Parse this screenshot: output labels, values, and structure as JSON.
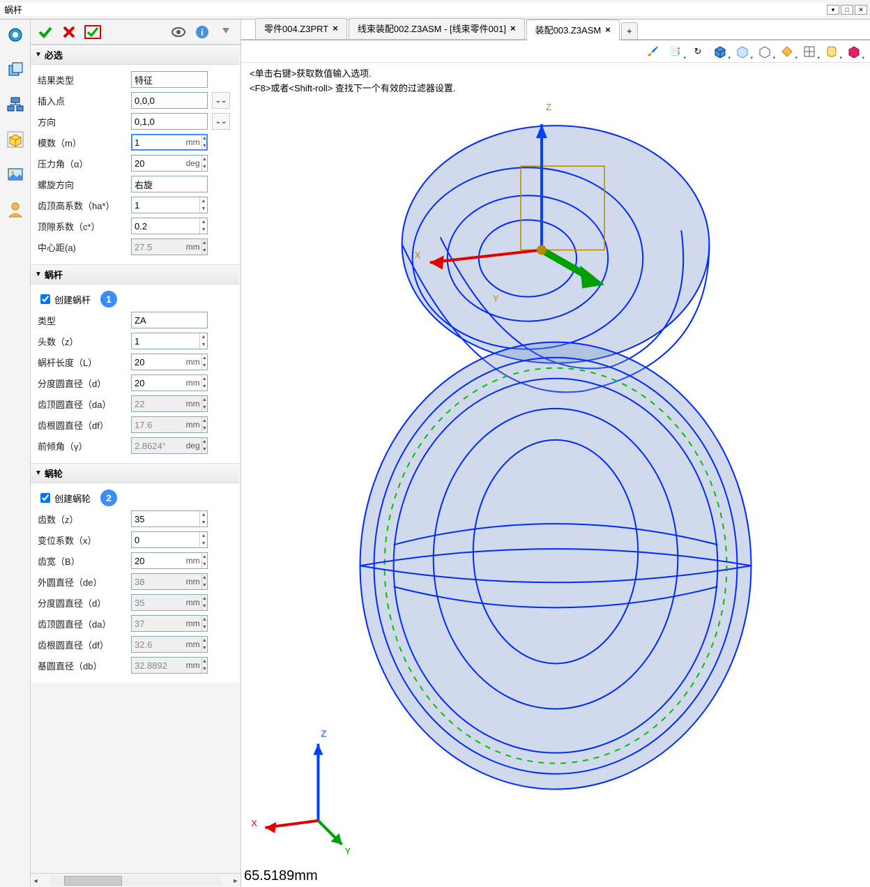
{
  "panel_title": "蜗杆",
  "tabs": [
    {
      "label": "零件004.Z3PRT",
      "active": false
    },
    {
      "label": "线束装配002.Z3ASM - [线束零件001]",
      "active": false
    },
    {
      "label": "装配003.Z3ASM",
      "active": true
    }
  ],
  "hints": [
    "<单击右键>获取数值输入选项.",
    "<F8>或者<Shift-roll> 查找下一个有效的过滤器设置."
  ],
  "readout": "65.5189mm",
  "axis_top": {
    "x": "X",
    "y": "Y",
    "z": "Z"
  },
  "axis_bottom": {
    "x": "X",
    "y": "Y",
    "z": "Z"
  },
  "sections": {
    "required": {
      "title": "必选",
      "result_type_label": "结果类型",
      "result_type_value": "特征",
      "insert_pt_label": "插入点",
      "insert_pt_value": "0,0,0",
      "direction_label": "方向",
      "direction_value": "0,1,0",
      "module_label": "模数（m）",
      "module_value": "1",
      "module_unit": "mm",
      "pressure_label": "压力角（α）",
      "pressure_value": "20",
      "pressure_unit": "deg",
      "helix_dir_label": "螺旋方向",
      "helix_dir_value": "右旋",
      "addendum_label": "齿顶高系数（ha*）",
      "addendum_value": "1",
      "clearance_label": "顶隙系数（c*）",
      "clearance_value": "0.2",
      "center_dist_label": "中心距(a)",
      "center_dist_value": "27.5",
      "center_dist_unit": "mm"
    },
    "worm": {
      "title": "蜗杆",
      "create_label": "创建蜗杆",
      "badge": "1",
      "type_label": "类型",
      "type_value": "ZA",
      "heads_label": "头数（z）",
      "heads_value": "1",
      "length_label": "蜗杆长度（L）",
      "length_value": "20",
      "length_unit": "mm",
      "pitch_d_label": "分度圆直径（d）",
      "pitch_d_value": "20",
      "pitch_d_unit": "mm",
      "tip_d_label": "齿顶圆直径（da）",
      "tip_d_value": "22",
      "tip_d_unit": "mm",
      "root_d_label": "齿根圆直径（df）",
      "root_d_value": "17.6",
      "root_d_unit": "mm",
      "lead_angle_label": "前倾角（γ）",
      "lead_angle_value": "2.8624°",
      "lead_angle_unit": "deg"
    },
    "wheel": {
      "title": "蜗轮",
      "create_label": "创建蜗轮",
      "badge": "2",
      "teeth_label": "齿数（z）",
      "teeth_value": "35",
      "shift_label": "变位系数（x）",
      "shift_value": "0",
      "width_label": "齿宽（B）",
      "width_value": "20",
      "width_unit": "mm",
      "outer_d_label": "外圆直径（de）",
      "outer_d_value": "38",
      "outer_d_unit": "mm",
      "pitch_d_label": "分度圆直径（d）",
      "pitch_d_value": "35",
      "pitch_d_unit": "mm",
      "tip_d_label": "齿顶圆直径（da）",
      "tip_d_value": "37",
      "tip_d_unit": "mm",
      "root_d_label": "齿根圆直径（df）",
      "root_d_value": "32.6",
      "root_d_unit": "mm",
      "base_d_label": "基圆直径（db）",
      "base_d_value": "32.8892",
      "base_d_unit": "mm"
    }
  }
}
